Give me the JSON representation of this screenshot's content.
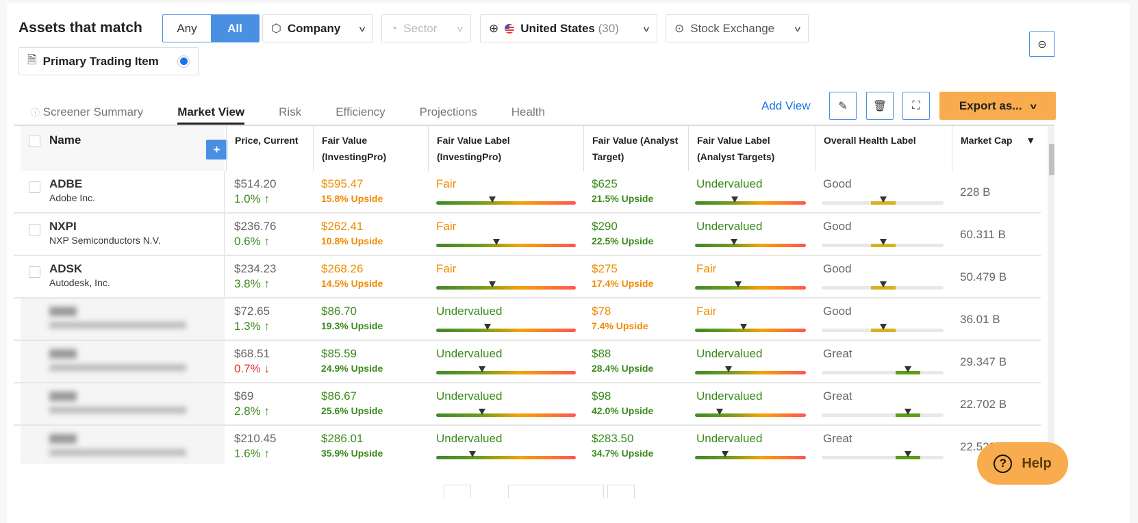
{
  "filters": {
    "title": "Assets that match",
    "match_any": "Any",
    "match_all": "All",
    "company": "Company",
    "sector": "Sector",
    "country": "United States",
    "country_count": "(30)",
    "exchange": "Stock Exchange",
    "primary": "Primary Trading Item"
  },
  "tabs": [
    {
      "label": "Screener Summary"
    },
    {
      "label": "Market View"
    },
    {
      "label": "Risk"
    },
    {
      "label": "Efficiency"
    },
    {
      "label": "Projections"
    },
    {
      "label": "Health"
    }
  ],
  "toolbar": {
    "add_view": "Add View",
    "export": "Export as..."
  },
  "columns": {
    "name": "Name",
    "price": "Price, Current",
    "fv": "Fair Value (InvestingPro)",
    "fvl": "Fair Value Label (InvestingPro)",
    "fva": "Fair Value (Analyst Target)",
    "fval": "Fair Value Label (Analyst Targets)",
    "health": "Overall Health Label",
    "mcap": "Market Cap",
    "sort_icon": "▼"
  },
  "colors": {
    "accent": "#4a90e2",
    "export": "#f8ac4d",
    "green": "#3a8a1b",
    "orange": "#f08a00",
    "red": "#e53030"
  },
  "rows": [
    {
      "ticker": "ADBE",
      "company": "Adobe Inc.",
      "price": "$514.20",
      "change": "1.0%",
      "dir": "up",
      "fv": "$595.47",
      "fv_up": "15.8% Upside",
      "fv_color": "orange",
      "fvl": "Fair",
      "fvl_color": "orange",
      "fvl_pos": 0.4,
      "fva": "$625",
      "fva_up": "21.5% Upside",
      "fva_color": "green",
      "fval": "Undervalued",
      "fval_color": "green",
      "fval_pos": 0.36,
      "health": "Good",
      "health_level": 3,
      "mcap": "228 B"
    },
    {
      "ticker": "NXPI",
      "company": "NXP Semiconductors N.V.",
      "price": "$236.76",
      "change": "0.6%",
      "dir": "up",
      "fv": "$262.41",
      "fv_up": "10.8% Upside",
      "fv_color": "orange",
      "fvl": "Fair",
      "fvl_color": "orange",
      "fvl_pos": 0.43,
      "fva": "$290",
      "fva_up": "22.5% Upside",
      "fva_color": "green",
      "fval": "Undervalued",
      "fval_color": "green",
      "fval_pos": 0.35,
      "health": "Good",
      "health_level": 3,
      "mcap": "60.311 B"
    },
    {
      "ticker": "ADSK",
      "company": "Autodesk, Inc.",
      "price": "$234.23",
      "change": "3.8%",
      "dir": "up",
      "fv": "$268.26",
      "fv_up": "14.5% Upside",
      "fv_color": "orange",
      "fvl": "Fair",
      "fvl_color": "orange",
      "fvl_pos": 0.4,
      "fva": "$275",
      "fva_up": "17.4% Upside",
      "fva_color": "orange",
      "fval": "Fair",
      "fval_color": "orange",
      "fval_pos": 0.39,
      "health": "Good",
      "health_level": 3,
      "mcap": "50.479 B"
    },
    {
      "ticker": "",
      "company": "",
      "blurred": true,
      "price": "$72.65",
      "change": "1.3%",
      "dir": "up",
      "fv": "$86.70",
      "fv_up": "19.3% Upside",
      "fv_color": "green",
      "fvl": "Undervalued",
      "fvl_color": "green",
      "fvl_pos": 0.37,
      "fva": "$78",
      "fva_up": "7.4% Upside",
      "fva_color": "orange",
      "fval": "Fair",
      "fval_color": "orange",
      "fval_pos": 0.44,
      "health": "Good",
      "health_level": 3,
      "mcap": "36.01 B"
    },
    {
      "ticker": "",
      "company": "",
      "blurred": true,
      "price": "$68.51",
      "change": "0.7%",
      "dir": "down",
      "fv": "$85.59",
      "fv_up": "24.9% Upside",
      "fv_color": "green",
      "fvl": "Undervalued",
      "fvl_color": "green",
      "fvl_pos": 0.33,
      "fva": "$88",
      "fva_up": "28.4% Upside",
      "fva_color": "green",
      "fval": "Undervalued",
      "fval_color": "green",
      "fval_pos": 0.3,
      "health": "Great",
      "health_level": 4,
      "mcap": "29.347 B"
    },
    {
      "ticker": "",
      "company": "",
      "blurred": true,
      "price": "$69",
      "change": "2.8%",
      "dir": "up",
      "fv": "$86.67",
      "fv_up": "25.6% Upside",
      "fv_color": "green",
      "fvl": "Undervalued",
      "fvl_color": "green",
      "fvl_pos": 0.33,
      "fva": "$98",
      "fva_up": "42.0% Upside",
      "fva_color": "green",
      "fval": "Undervalued",
      "fval_color": "green",
      "fval_pos": 0.22,
      "health": "Great",
      "health_level": 4,
      "mcap": "22.702 B"
    },
    {
      "ticker": "",
      "company": "",
      "blurred": true,
      "price": "$210.45",
      "change": "1.6%",
      "dir": "up",
      "fv": "$286.01",
      "fv_up": "35.9% Upside",
      "fv_color": "green",
      "fvl": "Undervalued",
      "fvl_color": "green",
      "fvl_pos": 0.26,
      "fva": "$283.50",
      "fva_up": "34.7% Upside",
      "fva_color": "green",
      "fval": "Undervalued",
      "fval_color": "green",
      "fval_pos": 0.27,
      "health": "Great",
      "health_level": 4,
      "mcap": "22.528 B"
    }
  ],
  "help": "Help"
}
